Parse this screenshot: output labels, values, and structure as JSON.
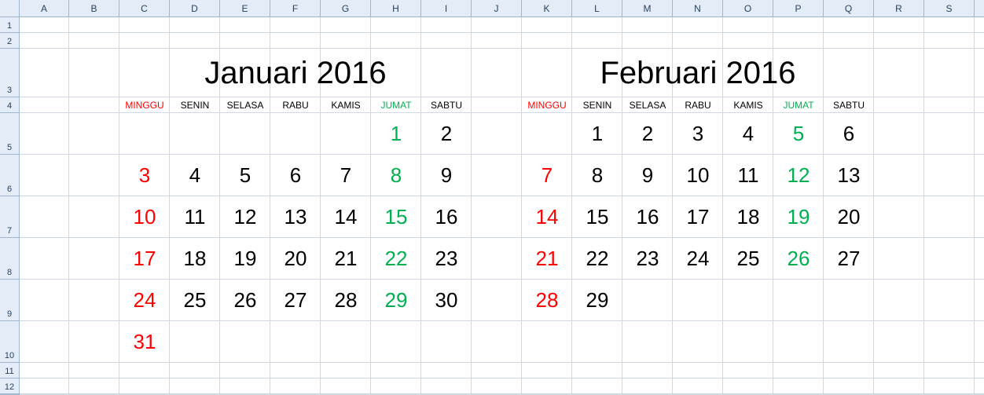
{
  "sheet": {
    "columns": [
      "A",
      "B",
      "C",
      "D",
      "E",
      "F",
      "G",
      "H",
      "I",
      "J",
      "K",
      "L",
      "M",
      "N",
      "O",
      "P",
      "Q",
      "R",
      "S"
    ],
    "rows": [
      "1",
      "2",
      "3",
      "4",
      "5",
      "6",
      "7",
      "8",
      "9",
      "10",
      "11",
      "12"
    ]
  },
  "colors": {
    "sunday": "#ff0000",
    "friday": "#00b050",
    "default": "#000000"
  },
  "calendars": [
    {
      "title": "Januari 2016",
      "day_names": [
        "MINGGU",
        "SENIN",
        "SELASA",
        "RABU",
        "KAMIS",
        "JUMAT",
        "SABTU"
      ],
      "weeks": [
        [
          "",
          "",
          "",
          "",
          "",
          "1",
          "2"
        ],
        [
          "3",
          "4",
          "5",
          "6",
          "7",
          "8",
          "9"
        ],
        [
          "10",
          "11",
          "12",
          "13",
          "14",
          "15",
          "16"
        ],
        [
          "17",
          "18",
          "19",
          "20",
          "21",
          "22",
          "23"
        ],
        [
          "24",
          "25",
          "26",
          "27",
          "28",
          "29",
          "30"
        ],
        [
          "31",
          "",
          "",
          "",
          "",
          "",
          ""
        ]
      ]
    },
    {
      "title": "Februari 2016",
      "day_names": [
        "MINGGU",
        "SENIN",
        "SELASA",
        "RABU",
        "KAMIS",
        "JUMAT",
        "SABTU"
      ],
      "weeks": [
        [
          "",
          "1",
          "2",
          "3",
          "4",
          "5",
          "6"
        ],
        [
          "7",
          "8",
          "9",
          "10",
          "11",
          "12",
          "13"
        ],
        [
          "14",
          "15",
          "16",
          "17",
          "18",
          "19",
          "20"
        ],
        [
          "21",
          "22",
          "23",
          "24",
          "25",
          "26",
          "27"
        ],
        [
          "28",
          "29",
          "",
          "",
          "",
          "",
          ""
        ]
      ]
    }
  ]
}
